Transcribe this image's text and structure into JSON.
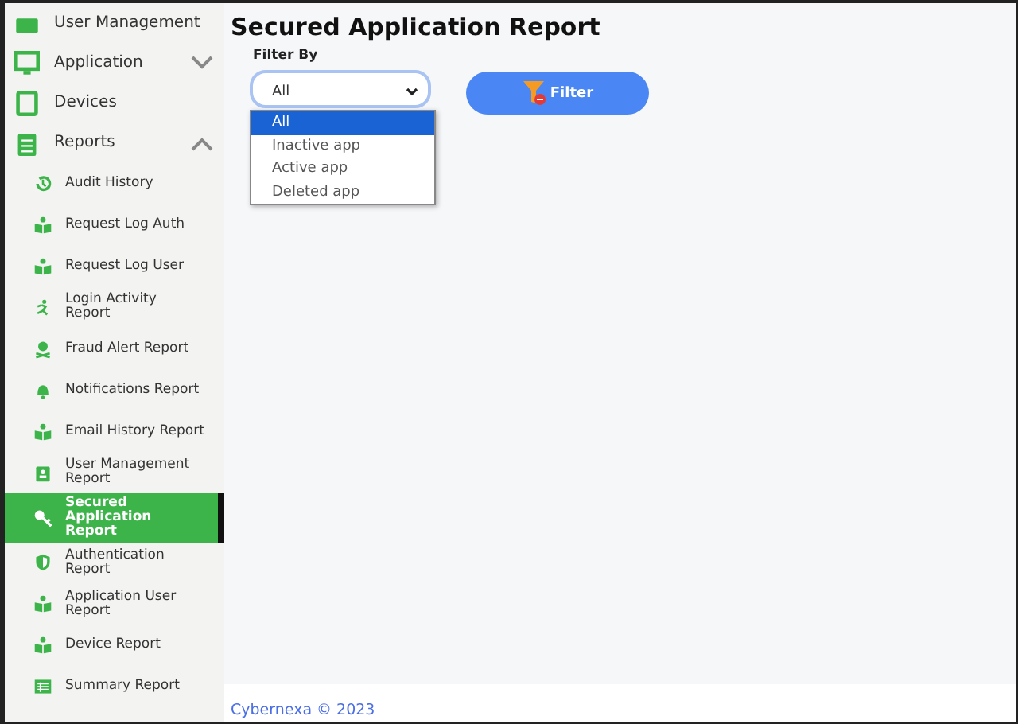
{
  "sidebar": {
    "items": [
      {
        "label": "User Management"
      },
      {
        "label": "Application",
        "expanded": false
      },
      {
        "label": "Devices"
      },
      {
        "label": "Reports",
        "expanded": true,
        "children": [
          {
            "label": "Audit History",
            "selected": false
          },
          {
            "label": "Request Log Auth",
            "selected": false
          },
          {
            "label": "Request Log User",
            "selected": false
          },
          {
            "label": "Login Activity Report",
            "selected": false
          },
          {
            "label": "Fraud Alert Report",
            "selected": false
          },
          {
            "label": "Notifications Report",
            "selected": false
          },
          {
            "label": "Email History Report",
            "selected": false
          },
          {
            "label": "User Management Report",
            "selected": false
          },
          {
            "label": "Secured Application Report",
            "selected": true
          },
          {
            "label": "Authentication Report",
            "selected": false
          },
          {
            "label": "Application User Report",
            "selected": false
          },
          {
            "label": "Device Report",
            "selected": false
          },
          {
            "label": "Summary Report",
            "selected": false
          }
        ]
      }
    ]
  },
  "page": {
    "title": "Secured Application Report",
    "filter": {
      "label": "Filter By",
      "value": "All",
      "options": [
        {
          "label": "All",
          "selected": true
        },
        {
          "label": "Inactive app",
          "selected": false
        },
        {
          "label": "Active app",
          "selected": false
        },
        {
          "label": "Deleted app",
          "selected": false
        }
      ]
    },
    "button": "Filter"
  },
  "footer": {
    "text": "Cybernexa ©  2023"
  }
}
